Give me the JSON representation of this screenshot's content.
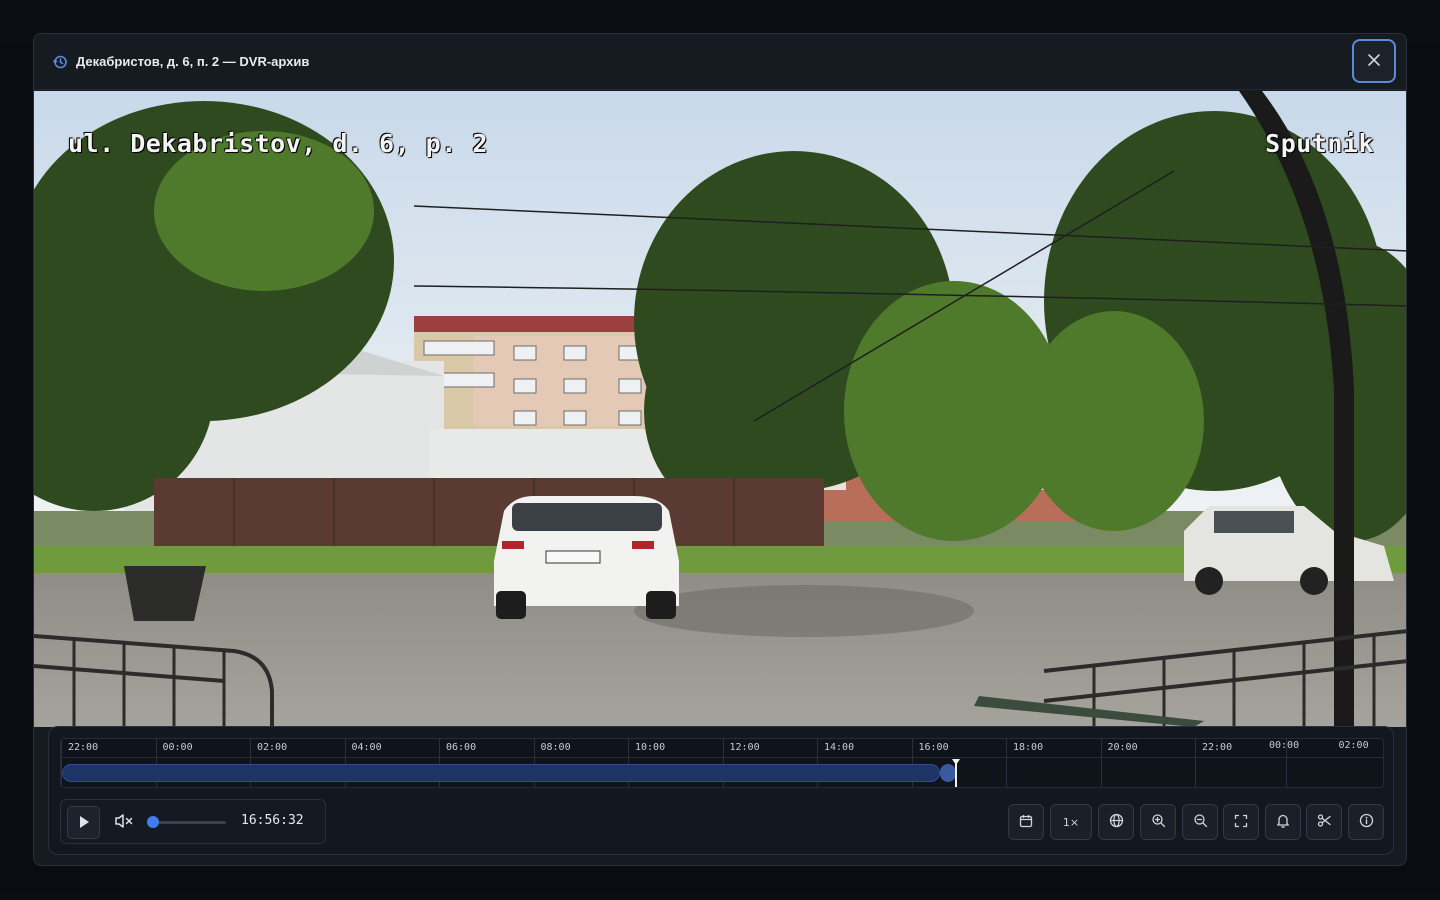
{
  "modal": {
    "title": "Декабристов, д. 6, п. 2 — DVR-архив"
  },
  "video": {
    "osd_left": "ul. Dekabristov, d. 6, p. 2",
    "osd_right": "Sputnik"
  },
  "timeline": {
    "labels": [
      "22:00",
      "00:00",
      "02:00",
      "04:00",
      "06:00",
      "08:00",
      "10:00",
      "12:00",
      "14:00",
      "16:00",
      "18:00",
      "20:00",
      "22:00",
      "02:00"
    ],
    "extra_label": "00:00"
  },
  "player": {
    "current_time": "16:56:32",
    "volume_fraction": 0.0
  },
  "toolbar": {
    "speed_label": "1×",
    "icons": [
      "calendar-icon",
      "speed",
      "globe-icon",
      "zoom-in-icon",
      "zoom-out-icon",
      "fullscreen-icon",
      "bell-icon",
      "scissors-icon",
      "info-icon"
    ]
  },
  "colors": {
    "accent": "#3f7ef2",
    "archive_fill": "#1e3466",
    "focus_ring": "#5b8bd9"
  }
}
